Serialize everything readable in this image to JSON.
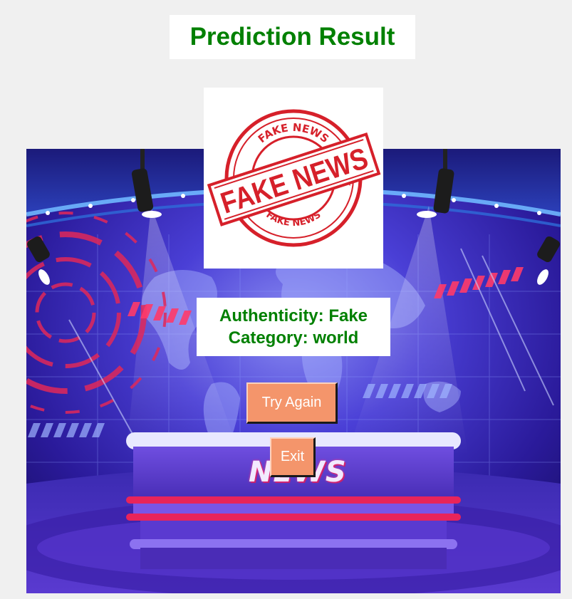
{
  "window": {
    "title": "Prediction Result"
  },
  "stamp": {
    "main_text": "FAKE NEWS",
    "ring_top_text": "FAKE NEWS",
    "ring_bottom_text": "FAKE NEWS",
    "color": "#d6202a"
  },
  "studio": {
    "desk_text": "NEWS"
  },
  "result": {
    "authenticity": "Authenticity: Fake",
    "category": "Category: world",
    "text_color": "#008000"
  },
  "buttons": {
    "try_again_label": "Try Again",
    "exit_label": "Exit",
    "color": "#f4956b"
  }
}
